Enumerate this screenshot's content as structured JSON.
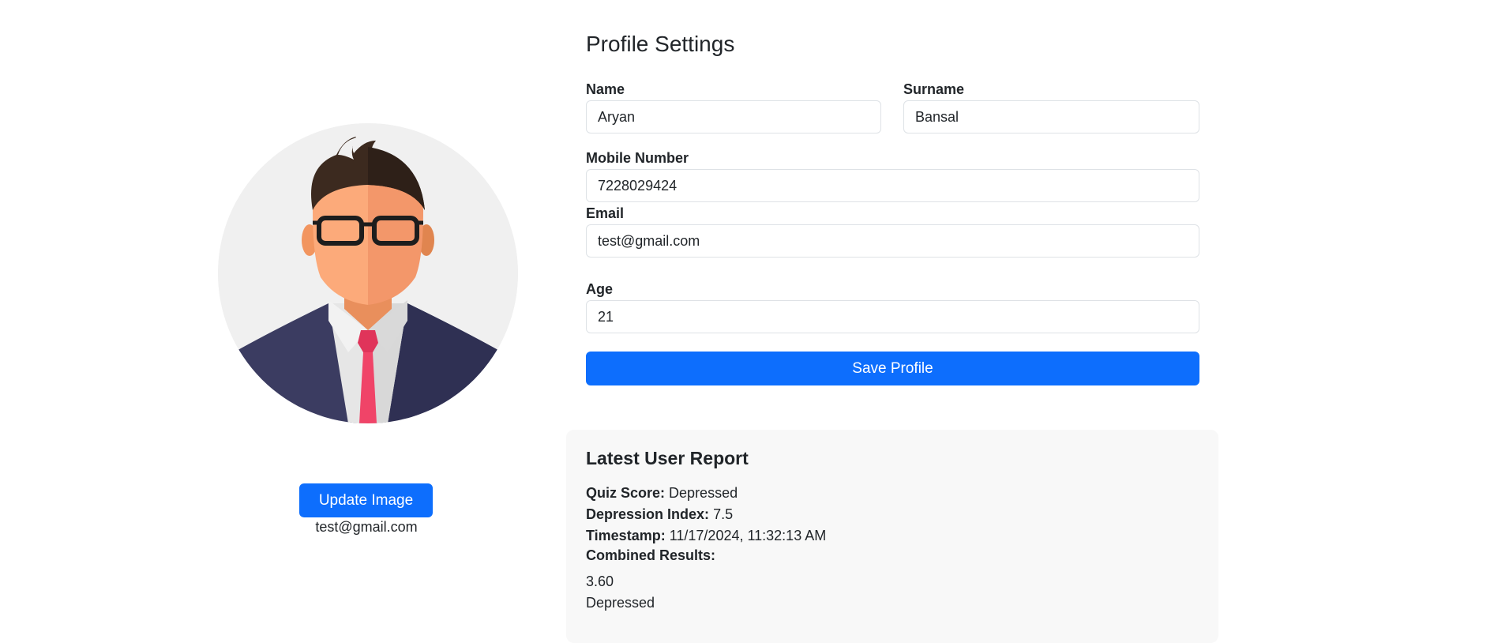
{
  "profile": {
    "title": "Profile Settings",
    "name_label": "Name",
    "name_value": "Aryan",
    "surname_label": "Surname",
    "surname_value": "Bansal",
    "mobile_label": "Mobile Number",
    "mobile_value": "7228029424",
    "email_label": "Email",
    "email_value": "test@gmail.com",
    "age_label": "Age",
    "age_value": "21",
    "save_label": "Save Profile"
  },
  "sidebar": {
    "update_image_label": "Update Image",
    "email": "test@gmail.com"
  },
  "report": {
    "title": "Latest User Report",
    "quiz_score_label": "Quiz Score:",
    "quiz_score_value": "Depressed",
    "depression_index_label": "Depression Index:",
    "depression_index_value": "7.5",
    "timestamp_label": "Timestamp:",
    "timestamp_value": "11/17/2024, 11:32:13 AM",
    "combined_label": "Combined Results:",
    "combined_score": "3.60",
    "combined_result": "Depressed"
  },
  "colors": {
    "primary": "#0d6efd",
    "report_bg": "#f8f8f8",
    "field_border": "#dee2e6"
  },
  "icons": {
    "avatar": "businessman-avatar-icon"
  }
}
